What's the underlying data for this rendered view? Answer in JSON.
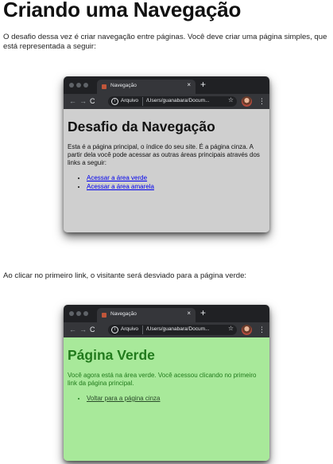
{
  "title": "Criando uma Navegação",
  "intro": "O desafio dessa vez é criar navegação entre páginas. Você deve criar uma página simples, que está representada a seguir:",
  "between": "Ao clicar no primeiro link, o visitante será desviado para a página verde:",
  "browser": {
    "tab_title": "Navegação",
    "tab_close": "×",
    "new_tab": "+",
    "back": "←",
    "forward": "→",
    "reload": "C",
    "scheme": "Arquivo",
    "path": "/Users/guanabara/Docum...",
    "star": "☆",
    "menu": "⋮",
    "info": "i"
  },
  "gray_page": {
    "heading": "Desafio da Navegação",
    "text": "Esta é a página principal, o índice do seu site. É a página cinza. A partir dela você pode acessar as outras áreas principais através dos links a seguir:",
    "links": [
      "Acessar a área verde",
      "Acessar a área amarela"
    ],
    "background": "#cfcfcf"
  },
  "green_page": {
    "heading": "Página Verde",
    "text": "Você agora está na área verde. Você acessou clicando no primeiro link da página principal.",
    "links": [
      "Voltar para a página cinza"
    ],
    "background": "#a8e99a",
    "text_color": "#217a1c"
  }
}
